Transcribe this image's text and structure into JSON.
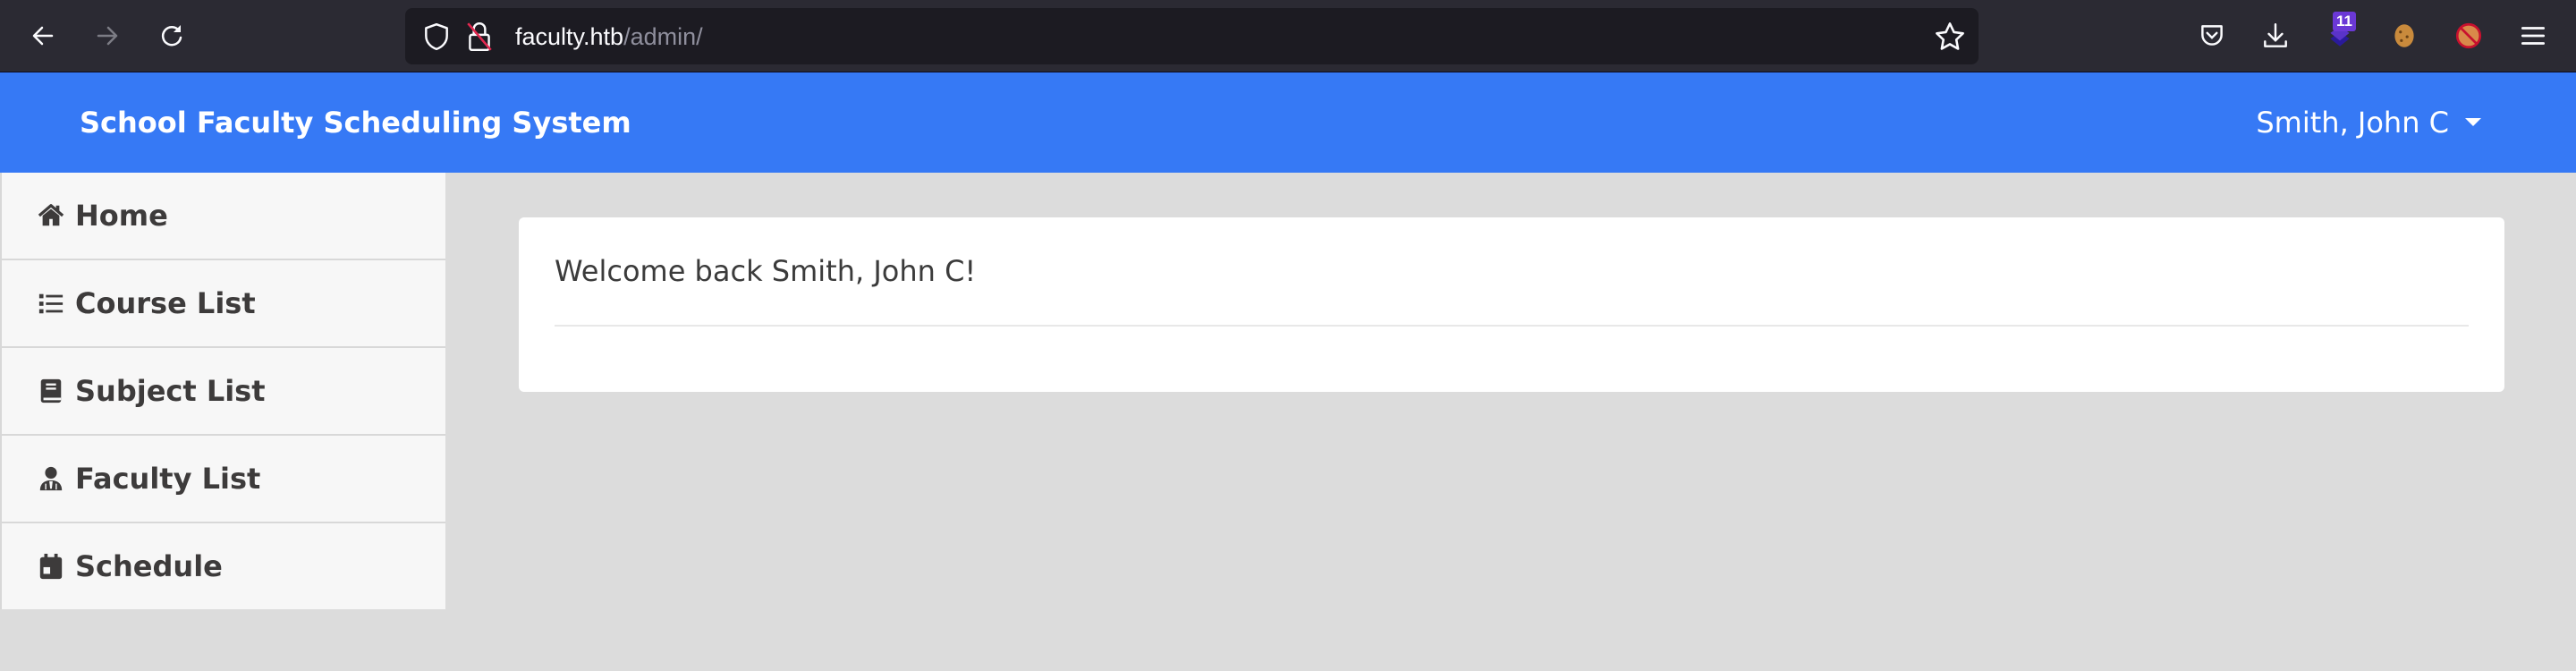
{
  "browser": {
    "url_host": "faculty.htb",
    "url_path": "/admin/",
    "extension_badge_count": "11",
    "icons": [
      "back-icon",
      "forward-icon",
      "reload-icon",
      "shield-icon",
      "insecure-lock-icon",
      "bookmark-star-icon",
      "pocket-icon",
      "download-icon",
      "extension-icon",
      "cookie-icon",
      "blocked-extension-icon",
      "hamburger-menu-icon"
    ]
  },
  "app": {
    "brand": "School Faculty Scheduling System",
    "user_name": "Smith, John C",
    "colors": {
      "navbar": "#3679f5",
      "sidebar_bg": "#f7f7f7",
      "page_bg": "#dcdcdc",
      "text": "#3d3b3b"
    }
  },
  "sidebar": {
    "items": [
      {
        "label": "Home",
        "icon": "home-icon"
      },
      {
        "label": "Course List",
        "icon": "list-icon"
      },
      {
        "label": "Subject List",
        "icon": "book-icon"
      },
      {
        "label": "Faculty List",
        "icon": "user-tie-icon"
      },
      {
        "label": "Schedule",
        "icon": "calendar-icon"
      }
    ]
  },
  "main": {
    "welcome_text": "Welcome back Smith, John C!"
  }
}
